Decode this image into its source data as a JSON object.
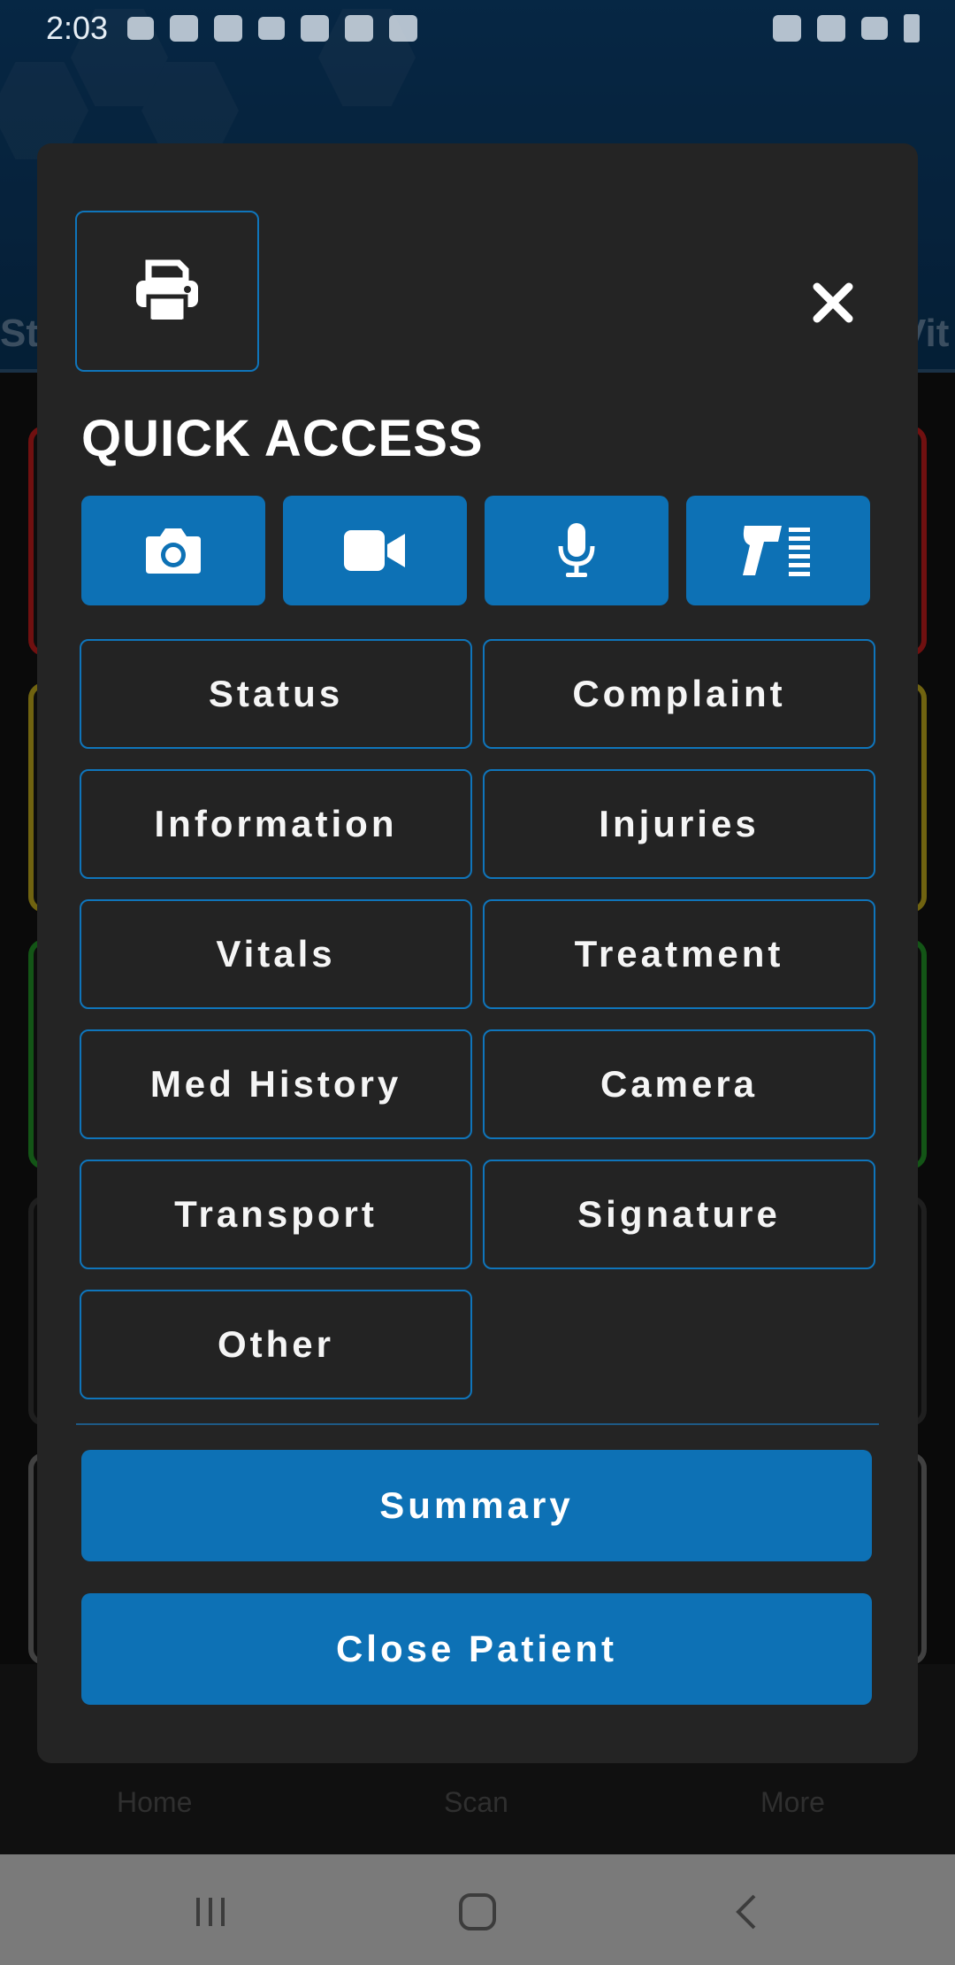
{
  "status_bar": {
    "time": "2:03"
  },
  "background": {
    "tab_left": "St",
    "tab_right": "Vit",
    "nav": {
      "home": "Home",
      "scan": "Scan",
      "more": "More"
    }
  },
  "modal": {
    "title": "QUICK ACCESS",
    "print_icon": "printer-icon",
    "close_icon": "close-icon",
    "media_buttons": [
      {
        "icon": "camera-icon"
      },
      {
        "icon": "video-icon"
      },
      {
        "icon": "microphone-icon"
      },
      {
        "icon": "barcode-scanner-icon"
      }
    ],
    "sections": [
      {
        "label": "Status"
      },
      {
        "label": "Complaint"
      },
      {
        "label": "Information"
      },
      {
        "label": "Injuries"
      },
      {
        "label": "Vitals"
      },
      {
        "label": "Treatment"
      },
      {
        "label": "Med History"
      },
      {
        "label": "Camera"
      },
      {
        "label": "Transport"
      },
      {
        "label": "Signature"
      },
      {
        "label": "Other"
      }
    ],
    "summary_label": "Summary",
    "close_patient_label": "Close Patient"
  },
  "colors": {
    "accent": "#0d71b5",
    "modal_bg": "#242424"
  }
}
